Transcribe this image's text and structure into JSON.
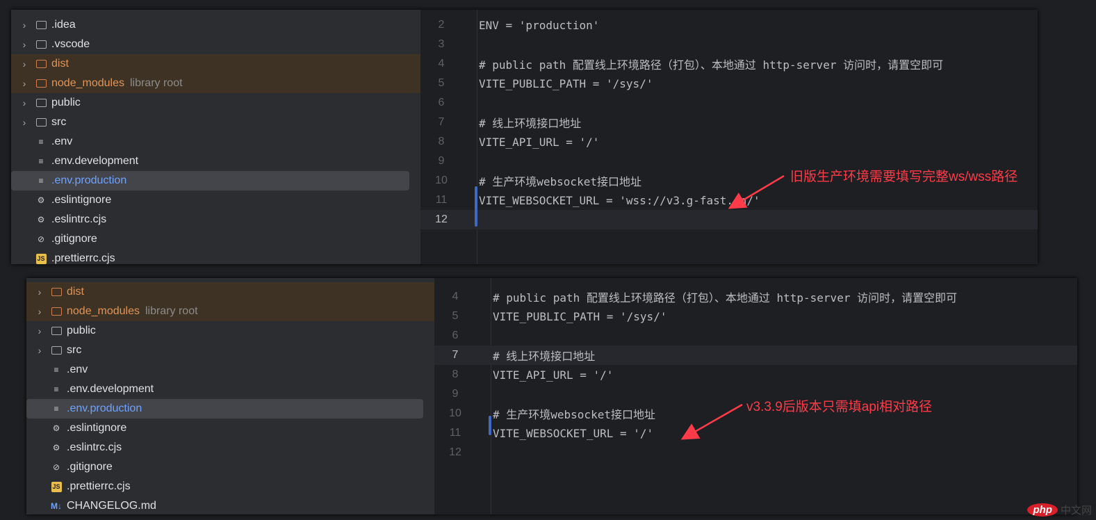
{
  "top": {
    "tree": [
      {
        "label": ".idea",
        "type": "folder",
        "chev": true
      },
      {
        "label": ".vscode",
        "type": "folder",
        "chev": true
      },
      {
        "label": "dist",
        "type": "folder",
        "chev": true,
        "excluded": true
      },
      {
        "label": "node_modules",
        "type": "folder",
        "chev": true,
        "excluded": true,
        "hint": "library root"
      },
      {
        "label": "public",
        "type": "folder",
        "chev": true
      },
      {
        "label": "src",
        "type": "folder",
        "chev": true
      },
      {
        "label": ".env",
        "type": "text"
      },
      {
        "label": ".env.development",
        "type": "text"
      },
      {
        "label": ".env.production",
        "type": "text",
        "selected": true
      },
      {
        "label": ".eslintignore",
        "type": "gear"
      },
      {
        "label": ".eslintrc.cjs",
        "type": "gear"
      },
      {
        "label": ".gitignore",
        "type": "ignore"
      },
      {
        "label": ".prettierrc.cjs",
        "type": "js"
      }
    ],
    "lines": [
      {
        "n": "2",
        "text": "ENV = 'production'"
      },
      {
        "n": "3",
        "text": ""
      },
      {
        "n": "4",
        "text": "# public path 配置线上环境路径（打包）、本地通过 http-server 访问时，请置空即可"
      },
      {
        "n": "5",
        "text": "VITE_PUBLIC_PATH = '/sys/'"
      },
      {
        "n": "6",
        "text": ""
      },
      {
        "n": "7",
        "text": "# 线上环境接口地址"
      },
      {
        "n": "8",
        "text": "VITE_API_URL = '/'"
      },
      {
        "n": "9",
        "text": ""
      },
      {
        "n": "10",
        "text": "# 生产环境websocket接口地址"
      },
      {
        "n": "11",
        "text": "VITE_WEBSOCKET_URL = 'wss://v3.g-fast.cn/'"
      },
      {
        "n": "12",
        "text": "",
        "current": true
      }
    ],
    "annotation": "旧版生产环境需要填写完整ws/wss路径"
  },
  "bottom": {
    "tree": [
      {
        "label": "dist",
        "type": "folder",
        "chev": true,
        "excluded": true
      },
      {
        "label": "node_modules",
        "type": "folder",
        "chev": true,
        "excluded": true,
        "hint": "library root"
      },
      {
        "label": "public",
        "type": "folder",
        "chev": true
      },
      {
        "label": "src",
        "type": "folder",
        "chev": true
      },
      {
        "label": ".env",
        "type": "text"
      },
      {
        "label": ".env.development",
        "type": "text"
      },
      {
        "label": ".env.production",
        "type": "text",
        "selected": true
      },
      {
        "label": ".eslintignore",
        "type": "gear"
      },
      {
        "label": ".eslintrc.cjs",
        "type": "gear"
      },
      {
        "label": ".gitignore",
        "type": "ignore"
      },
      {
        "label": ".prettierrc.cjs",
        "type": "js"
      },
      {
        "label": "CHANGELOG.md",
        "type": "md"
      }
    ],
    "lines": [
      {
        "n": "4",
        "text": "# public path 配置线上环境路径（打包）、本地通过 http-server 访问时，请置空即可"
      },
      {
        "n": "5",
        "text": "VITE_PUBLIC_PATH = '/sys/'"
      },
      {
        "n": "6",
        "text": ""
      },
      {
        "n": "7",
        "text": "# 线上环境接口地址",
        "current": true
      },
      {
        "n": "8",
        "text": "VITE_API_URL = '/'"
      },
      {
        "n": "9",
        "text": ""
      },
      {
        "n": "10",
        "text": "# 生产环境websocket接口地址"
      },
      {
        "n": "11",
        "text": "VITE_WEBSOCKET_URL = '/'"
      },
      {
        "n": "12",
        "text": ""
      }
    ],
    "annotation": "v3.3.9后版本只需填api相对路径"
  },
  "watermark": {
    "logo": "php",
    "text": "中文网"
  },
  "colors": {
    "annotation": "#ff3b4a",
    "selected_text": "#6fa3ff",
    "excluded": "#e0955a"
  }
}
